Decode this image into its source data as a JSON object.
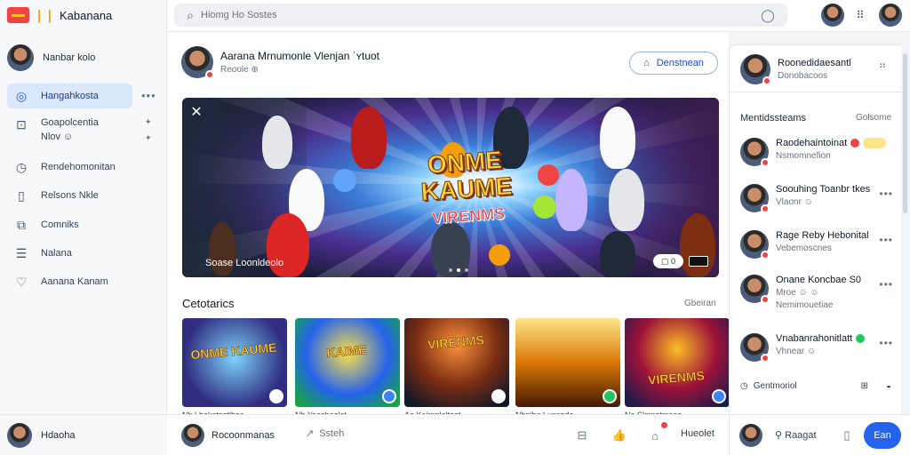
{
  "app": {
    "brand": "Kabanana"
  },
  "search": {
    "placeholder": "Hiomg Ho Sostes"
  },
  "sidebar": {
    "profile_name": "Nanbar kolo",
    "items": [
      {
        "label": "Hangahkosta",
        "icon": "compass-icon"
      },
      {
        "label": "Goapolcentia",
        "sub": "Nlov ☺",
        "icon": "image-icon"
      },
      {
        "label": "Rendehomonitan",
        "icon": "clock-icon"
      },
      {
        "label": "Relsons Nkle",
        "icon": "bookmark-icon"
      },
      {
        "label": "Comniks",
        "icon": "puzzle-icon"
      },
      {
        "label": "Nalana",
        "icon": "list-icon"
      },
      {
        "label": "Aanana Kanam",
        "icon": "heart-icon"
      }
    ],
    "footer_name": "Hdaoha"
  },
  "post": {
    "title": "Aarana Mrnumonle Vlenjan ˈʏtuot",
    "subtitle": "Reoole ⊕",
    "follow_label": "Denstnean"
  },
  "hero": {
    "title_lines": [
      "ONME",
      "KAUME",
      "VIRENMS"
    ],
    "caption": "Soase Loonldeolo",
    "control": "▢ 0"
  },
  "section": {
    "title": "Cetotarics",
    "more": "Gbeiran",
    "thumbs": [
      {
        "title": "ONME KAUME",
        "caption": "Nh Lhokotsatlhas"
      },
      {
        "title": "KAIME",
        "caption": "Nh Yeoshaolat"
      },
      {
        "title": "VIRENMS",
        "caption": "Ao Koirnnlolteat"
      },
      {
        "title": "",
        "caption": "Nhnibe Lunseda"
      },
      {
        "title": "VIRENMS",
        "caption": "Ne Slmnatmosa"
      }
    ]
  },
  "right_panel": {
    "profile": {
      "name": "Roonedidaesantl",
      "sub": "Donobacoos"
    },
    "header": "Mentidssteams",
    "header_more": "Golsome",
    "people": [
      {
        "name": "Raodehaintoinat",
        "sub": "Nsmomnefion"
      },
      {
        "name": "Soouhing Toanbr tkes",
        "sub": "Vlaonr ☺"
      },
      {
        "name": "Rage Reby Hebonital",
        "sub": "Vebemoscnes"
      },
      {
        "name": "Onane Koncbae S0",
        "sub": "Mroe ☺ ☺",
        "sub2": "Nemimouetiae"
      },
      {
        "name": "Vnabanrahonitlatt",
        "sub": "Vhnear ☺"
      }
    ],
    "footer": "Gentmoriol"
  },
  "bottom": {
    "user": "Rocoonmanas",
    "share": "Ssteh",
    "wave": "Hueolet",
    "right_user": "Raagat",
    "send": "Ean"
  },
  "colors": {
    "accent": "#2563eb",
    "active_nav": "#dbe8fb"
  }
}
